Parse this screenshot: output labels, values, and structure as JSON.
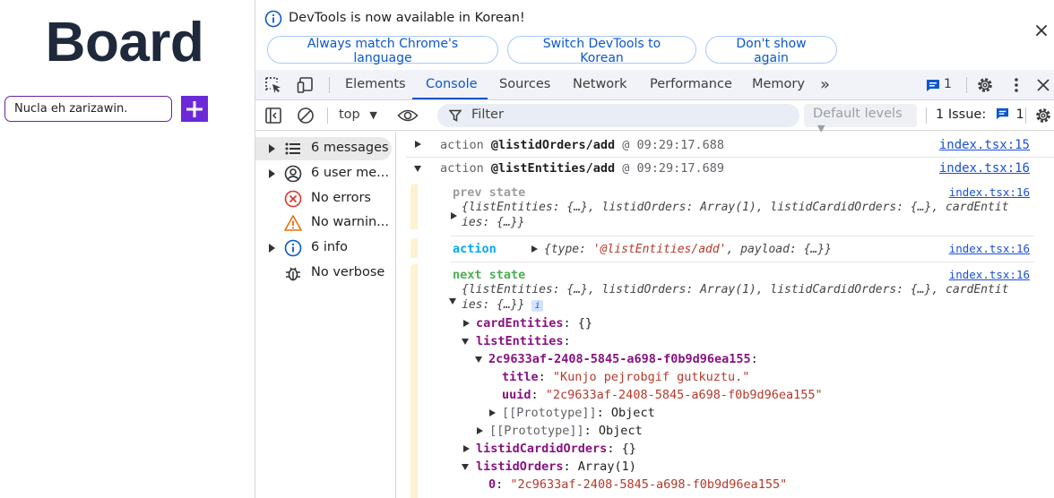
{
  "app": {
    "title": "Board",
    "input_value": "Nucla eh zarizawin.",
    "add_button_label": "+"
  },
  "infobar": {
    "message": "DevTools is now available in Korean!",
    "btn_match": "Always match Chrome's language",
    "btn_switch": "Switch DevTools to Korean",
    "btn_dont_show": "Don't show again",
    "close": "×"
  },
  "tabs": {
    "elements": "Elements",
    "console": "Console",
    "sources": "Sources",
    "network": "Network",
    "performance": "Performance",
    "memory": "Memory",
    "more": "»",
    "issue_count": "1"
  },
  "toolbar": {
    "context": "top",
    "filter_placeholder": "Filter",
    "levels": "Default levels",
    "issues_label": "1 Issue:",
    "issues_count": "1"
  },
  "sidebar": {
    "messages": "6 messages",
    "user_messages": "6 user me...",
    "errors": "No errors",
    "warnings": "No warnin...",
    "info": "6 info",
    "verbose": "No verbose"
  },
  "console": {
    "log1": {
      "prefix": "action",
      "name": "@listidOrders/add",
      "time": "@ 09:29:17.688",
      "link": "index.tsx:15"
    },
    "log2": {
      "prefix": "action",
      "name": "@listEntities/add",
      "time": "@ 09:29:17.689",
      "link": "index.tsx:16"
    },
    "prev": {
      "label": "prev state",
      "link": "index.tsx:16",
      "summary1": "{listEntities: {…}, listidOrders: Array(1), listidCardidOrders: {…}, cardEntit",
      "summary2": "ies: {…}}"
    },
    "action": {
      "label": "action",
      "open": "{type: ",
      "type_value": "'@listEntities/add'",
      "rest": ", payload: {…}}",
      "link": "index.tsx:16"
    },
    "next": {
      "label": "next state",
      "link": "index.tsx:16",
      "summary1": "{listEntities: {…}, listidOrders: Array(1), listidCardidOrders: {…}, cardEntit",
      "summary2": "ies: {…}}",
      "info_badge": "i",
      "cardEntities_key": "cardEntities",
      "cardEntities_val": ": {}",
      "listEntities_key": "listEntities",
      "listEntities_val": ":",
      "entity_key": "2c9633af-2408-5845-a698-f0b9d96ea155",
      "entity_val": ":",
      "title_key": "title",
      "title_val": "\"Kunjo pejrobgif gutkuztu.\"",
      "uuid_key": "uuid",
      "uuid_val": "\"2c9633af-2408-5845-a698-f0b9d96ea155\"",
      "proto_inner": "[[Prototype]]",
      "proto_inner_val": ": Object",
      "proto_outer": "[[Prototype]]",
      "proto_outer_val": ": Object",
      "listidCardidOrders_key": "listidCardidOrders",
      "listidCardidOrders_val": ": {}",
      "listidOrders_key": "listidOrders",
      "listidOrders_val": ": Array(1)",
      "index0_key": "0",
      "index0_val": "\"2c9633af-2408-5845-a698-f0b9d96ea155\""
    }
  },
  "colors": {
    "accent": "#0b57d0",
    "add_button": "#6d28d9",
    "input_border": "#6b21a8",
    "title": "#1e293b",
    "prev_label": "#9e9e9e",
    "action_label": "#03a9f4",
    "next_label": "#4caf50",
    "group_bar": "#fdf3d1"
  }
}
